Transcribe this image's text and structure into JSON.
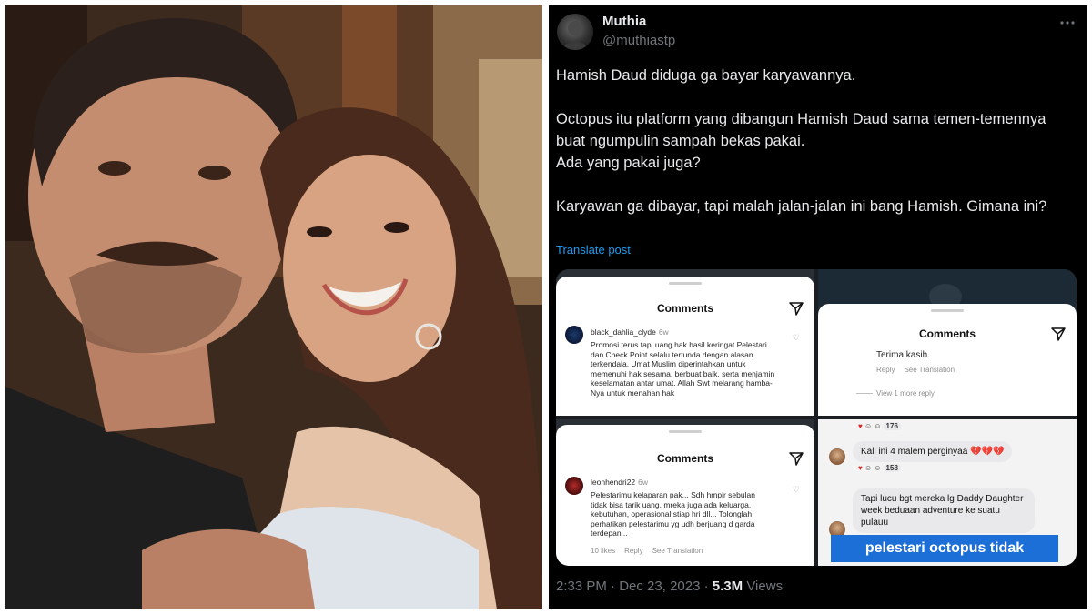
{
  "author": {
    "name": "Muthia",
    "handle": "@muthiastp"
  },
  "tweet": {
    "text": "Hamish Daud diduga ga bayar karyawannya.\n\nOctopus itu platform yang dibangun Hamish Daud sama temen-temennya buat ngumpulin sampah bekas pakai.\nAda yang pakai juga?\n\nKaryawan ga dibayar, tapi malah jalan-jalan ini bang Hamish. Gimana ini?",
    "translate_label": "Translate post",
    "time": "2:33 PM",
    "separator": "·",
    "date": "Dec 23, 2023",
    "views_count": "5.3M",
    "views_label": "Views"
  },
  "media": {
    "shot1": {
      "title": "Comments",
      "username": "black_dahlia_clyde",
      "time": "6w",
      "comment": "Promosi terus tapi uang hak hasil keringat Pelestari dan Check Point selalu tertunda dengan alasan terkendala. Umat Muslim diperintahkan untuk memenuhi hak sesama, berbuat baik, serta menjamin keselamatan antar umat. Allah Swt melarang hamba-Nya untuk menahan hak"
    },
    "shot2": {
      "title": "Comments",
      "reply_text": "Terima kasih.",
      "reply_label": "Reply",
      "see_translation": "See Translation",
      "view_more": "View 1 more reply"
    },
    "shot3": {
      "title": "Comments",
      "username": "leonhendri22",
      "time": "6w",
      "comment": "Pelestarimu kelaparan pak... Sdh hmpir sebulan tidak bisa tarik uang, mreka juga ada keluarga, kebutuhan, operasional stiap hri dll... Tolonglah perhatikan pelestarimu yg udh berjuang d garda terdepan...",
      "likes": "10 likes",
      "reply_label": "Reply",
      "see_translation": "See Translation"
    },
    "shot4": {
      "reaction_count_1": "176",
      "message_1": "Kali ini 4 malem perginyaa 💔💔💔",
      "reaction_count_2": "158",
      "message_2": "Tapi lucu bgt mereka lg Daddy Daughter week beduaan adventure ke suatu pulauu",
      "caption": "pelestari octopus tidak"
    }
  },
  "colors": {
    "background": "#000000",
    "link": "#1d9bf0",
    "muted": "#71767b",
    "caption_bg": "#1d6fd8"
  }
}
